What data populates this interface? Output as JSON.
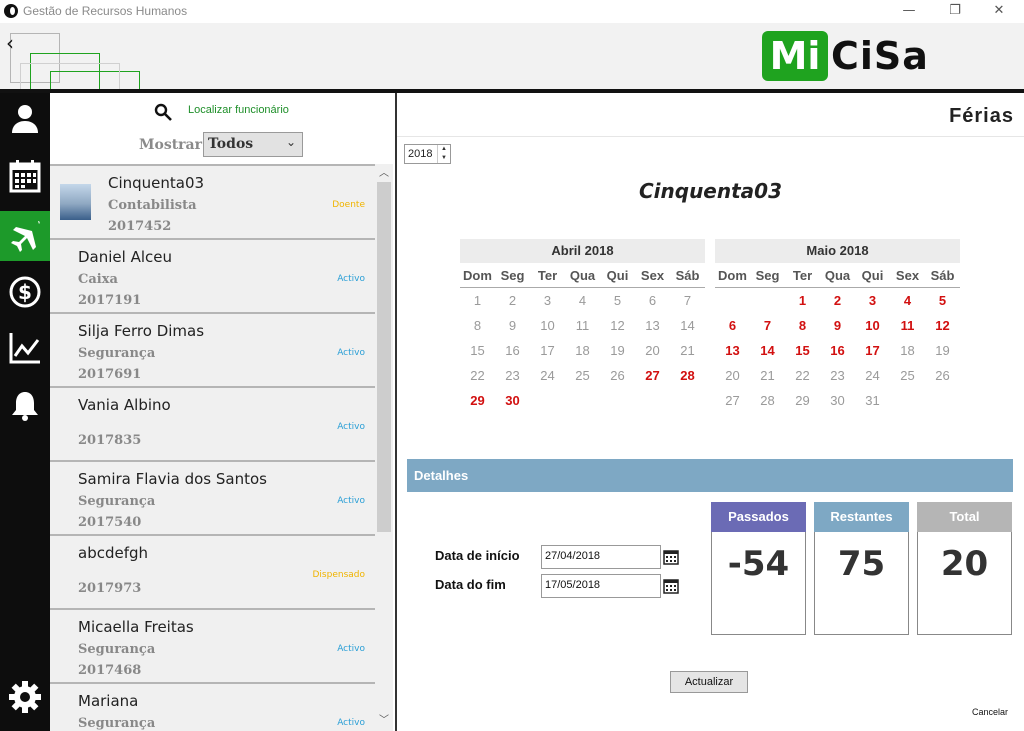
{
  "window": {
    "title": "Gestão de Recursos Humanos",
    "minimize": "—",
    "restore": "❐",
    "close": "✕"
  },
  "header": {
    "back": "‹",
    "logo_left": "Mi",
    "logo_right": "CiSa"
  },
  "nav": [
    {
      "name": "user-icon"
    },
    {
      "name": "calendar-icon"
    },
    {
      "name": "airplane-icon",
      "active": true
    },
    {
      "name": "dollar-icon"
    },
    {
      "name": "chart-icon"
    },
    {
      "name": "bell-icon"
    },
    {
      "name": "settings-icon"
    }
  ],
  "search": {
    "label": "Localizar funcionário"
  },
  "filter": {
    "label": "Mostrar",
    "value": "Todos"
  },
  "employees": [
    {
      "name": "Cinquenta03",
      "role": "Contabilista",
      "id": "2017452",
      "status": "Doente",
      "status_color": "#f0b400",
      "photo": true
    },
    {
      "name": "Daniel Alceu",
      "role": "Caixa",
      "id": "2017191",
      "status": "Activo",
      "status_color": "#2a9fd6"
    },
    {
      "name": "Silja Ferro Dimas",
      "role": "Segurança",
      "id": "2017691",
      "status": "Activo",
      "status_color": "#2a9fd6"
    },
    {
      "name": "Vania Albino",
      "role": "",
      "id": "2017835",
      "status": "Activo",
      "status_color": "#2a9fd6"
    },
    {
      "name": "Samira Flavia dos Santos",
      "role": "Segurança",
      "id": "2017540",
      "status": "Activo",
      "status_color": "#2a9fd6"
    },
    {
      "name": "abcdefgh",
      "role": "",
      "id": "2017973",
      "status": "Dispensado",
      "status_color": "#f0b400"
    },
    {
      "name": "Micaella Freitas",
      "role": "Segurança",
      "id": "2017468",
      "status": "Activo",
      "status_color": "#2a9fd6"
    },
    {
      "name": "Mariana",
      "role": "Segurança",
      "id": "",
      "status": "Activo",
      "status_color": "#2a9fd6"
    }
  ],
  "main": {
    "title": "Férias",
    "year": "2018",
    "employee": "Cinquenta03",
    "weekdays": [
      "Dom",
      "Seg",
      "Ter",
      "Qua",
      "Qui",
      "Sex",
      "Sáb"
    ],
    "months": [
      {
        "title": "Abril 2018",
        "offset": 0,
        "days": 30,
        "vacation": [
          27,
          28,
          29,
          30
        ]
      },
      {
        "title": "Maio 2018",
        "offset": 2,
        "days": 31,
        "vacation": [
          1,
          2,
          3,
          4,
          5,
          6,
          7,
          8,
          9,
          10,
          11,
          12,
          13,
          14,
          15,
          16,
          17
        ]
      }
    ],
    "details": "Detalhes",
    "start_label": "Data de início",
    "start_value": "27/04/2018",
    "end_label": "Data do fim",
    "end_value": "17/05/2018",
    "stats": [
      {
        "label": "Passados",
        "value": "-54",
        "color": "#6b6bb5"
      },
      {
        "label": "Restantes",
        "value": "75",
        "color": "#7ea8c4"
      },
      {
        "label": "Total",
        "value": "20",
        "color": "#b5b5b5"
      }
    ],
    "update": "Actualizar",
    "cancel": "Cancelar"
  }
}
